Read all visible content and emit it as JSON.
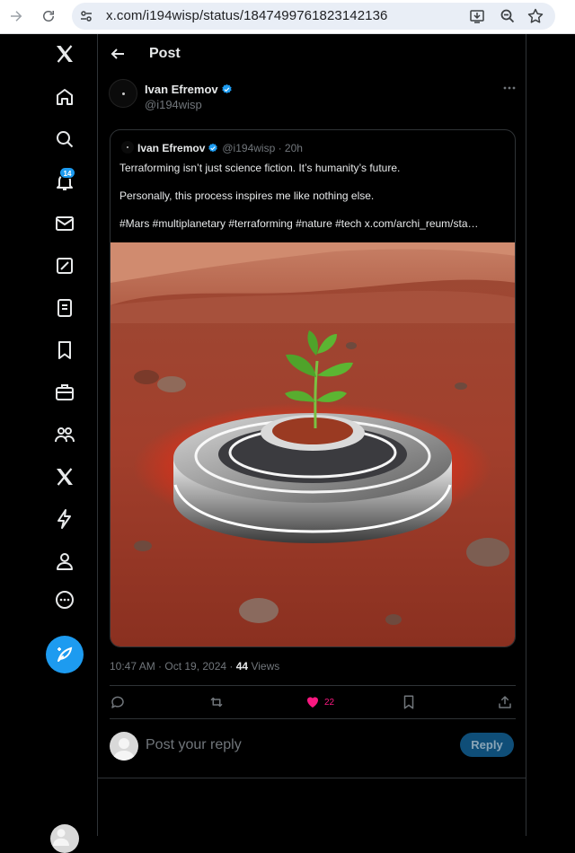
{
  "browser": {
    "url": "x.com/i194wisp/status/1847499761823142136",
    "icons": [
      "back-arrow-icon",
      "reload-icon",
      "site-settings-icon",
      "install-app-icon",
      "zoom-icon",
      "bookmark-star-icon"
    ]
  },
  "nav": {
    "items": [
      {
        "name": "x-logo-icon"
      },
      {
        "name": "home-icon"
      },
      {
        "name": "explore-icon"
      },
      {
        "name": "notifications-icon",
        "badge": "14"
      },
      {
        "name": "messages-icon"
      },
      {
        "name": "grok-icon"
      },
      {
        "name": "lists-icon"
      },
      {
        "name": "bookmarks-icon"
      },
      {
        "name": "jobs-icon"
      },
      {
        "name": "communities-icon"
      },
      {
        "name": "premium-icon"
      },
      {
        "name": "verified-orgs-icon"
      },
      {
        "name": "profile-icon"
      },
      {
        "name": "more-icon"
      }
    ],
    "post_button_icon": "compose-icon"
  },
  "header": {
    "title": "Post"
  },
  "post": {
    "author_name": "Ivan Efremov",
    "author_handle": "@i194wisp",
    "views_time": "10:47 AM · Oct 19, 2024 · ",
    "views_count": "44",
    "views_label": " Views",
    "likes": "22"
  },
  "quote": {
    "author_name": "Ivan Efremov",
    "meta": "@i194wisp · 20h",
    "line1": "Terraforming isn’t just science fiction. It’s humanity’s future.",
    "line2": "Personally, this process inspires me like nothing else.",
    "line3": "#Mars #multiplanetary #terraforming #nature #tech  x.com/archi_reum/sta…"
  },
  "reply": {
    "placeholder": "Post your reply",
    "button": "Reply"
  },
  "colors": {
    "accent": "#1d9bf0",
    "like": "#f91880",
    "border": "#2f3336",
    "muted": "#71767b"
  }
}
